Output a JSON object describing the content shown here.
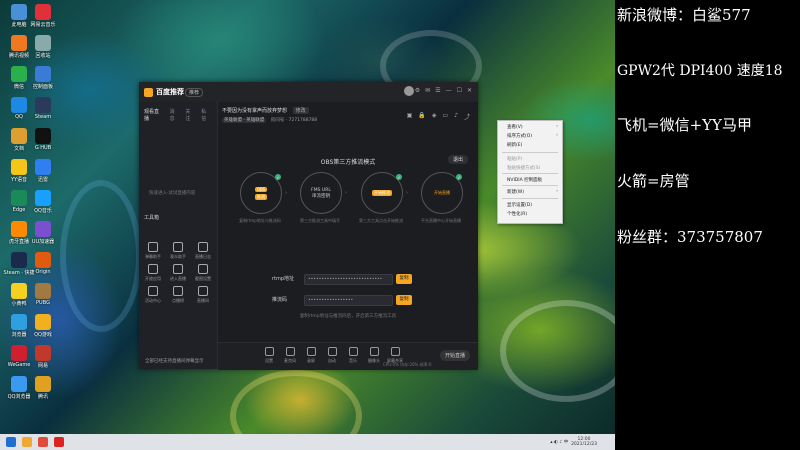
{
  "overlay": {
    "lines": [
      "新浪微博：白鲨577",
      "GPW2代 DPI400 速度18",
      "飞机=微信+YY马甲",
      "火箭=房管",
      "粉丝群：373757807"
    ]
  },
  "app": {
    "name": "百度推荐",
    "badge": "推荐",
    "left_tabs": [
      "观看直播",
      "消息",
      "关注",
      "私信"
    ],
    "left_hint": "快速进入·试试直播内容",
    "toolbox_label": "工具箱",
    "tools": [
      "弹幕助手",
      "观众助手",
      "直播日志",
      "开放应用",
      "进入直播",
      "截图设置",
      "活动中心",
      "点播榜",
      "直播间"
    ],
    "footer_text": "全部已经支持直播间弹幕显示",
    "stream_title": "不要因为没有掌声而放弃梦想",
    "edit_label": "修改",
    "sub_tag": "英雄联盟 · 英雄联盟",
    "sub_info": "房间号 · 7271788788",
    "obs_title": "OBS第三方推流模式",
    "exit_label": "退出",
    "steps": [
      {
        "top": "OBS",
        "bottom": "推流",
        "caption": "复制rtmp地址与推流码"
      },
      {
        "top": "FMS URL",
        "bottom": "串流密钥",
        "caption": "第三方推流工具中填写"
      },
      {
        "top": "开始推流",
        "bottom": "",
        "caption": "第三方工具点击开始推流"
      },
      {
        "top": "开始直播",
        "bottom": "",
        "caption": "平台直播中心开始直播"
      }
    ],
    "rtmp_label": "rtmp地址",
    "rtmp_value": "••••••••••••••••••••••••••••",
    "key_label": "推流码",
    "key_value": "•••••••••••••••••",
    "copy_label": "复制",
    "field_hint": "复制rtmp地址与推流码后，开启第三方推流工具",
    "bottom_items": [
      "设置",
      "麦克风",
      "录屏",
      "自动",
      "音乐",
      "摄像头",
      "屏幕共享"
    ],
    "start_label": "开始直播",
    "stats": "CPU:0%  内存:20%  帧率:0"
  },
  "context_menu": {
    "items": [
      {
        "label": "查看(V)",
        "disabled": false,
        "submenu": true
      },
      {
        "label": "排序方式(O)",
        "disabled": false,
        "submenu": true
      },
      {
        "label": "刷新(E)",
        "disabled": false,
        "submenu": false
      },
      {
        "label": "粘贴(P)",
        "disabled": true,
        "submenu": false
      },
      {
        "label": "粘贴快捷方式(S)",
        "disabled": true,
        "submenu": false
      },
      {
        "label": "NVIDIA 控制面板",
        "disabled": false,
        "submenu": false
      },
      {
        "label": "新建(W)",
        "disabled": false,
        "submenu": true
      },
      {
        "label": "显示设置(D)",
        "disabled": false,
        "submenu": false
      },
      {
        "label": "个性化(R)",
        "disabled": false,
        "submenu": false
      }
    ]
  },
  "desktop_icons": [
    "此电脑",
    "网易云音乐",
    "腾讯视频",
    "回收站",
    "微信",
    "控制面板",
    "QQ",
    "Steam",
    "文档",
    "G HUB",
    "YY语音",
    "迅雷",
    "Edge",
    "QQ音乐",
    "虎牙直播",
    "UU加速器",
    "Steam · 快捷",
    "Origin",
    "小黄鸭",
    "PUBG",
    "浏览器",
    "QQ游戏",
    "WeGame",
    "网易",
    "QQ浏览器",
    "腾讯"
  ],
  "taskbar": {
    "time": "12:00",
    "date": "2021/12/23"
  },
  "colors": {
    "accent": "#f5a623",
    "panel": "#1c1d21",
    "success": "#3bb27a"
  }
}
